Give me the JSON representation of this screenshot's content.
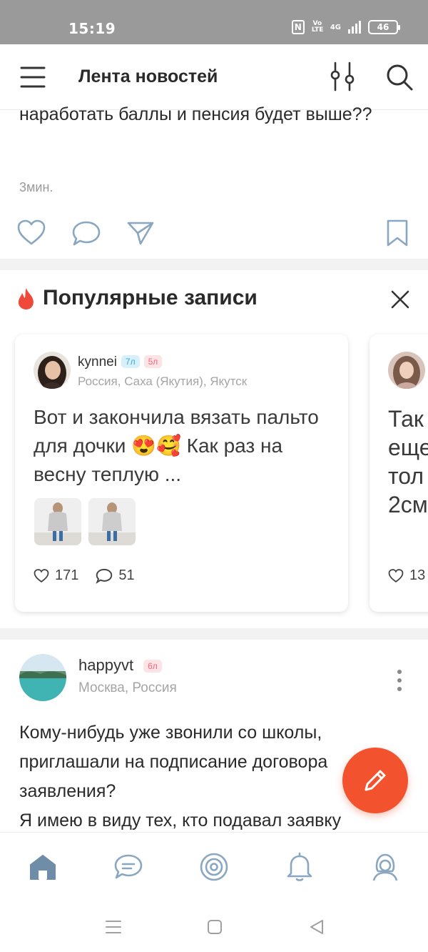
{
  "status_bar": {
    "time": "15:19",
    "nfc": "N",
    "volte": "Vo LTE",
    "network": "4G",
    "battery": "46"
  },
  "header": {
    "title": "Лента новостей",
    "menu_icon": "hamburger-icon",
    "filter_icon": "filter-icon",
    "search_icon": "search-icon"
  },
  "post1": {
    "text": "наработать баллы и пенсия будет выше??",
    "time": "3мин."
  },
  "popular": {
    "title": "Популярные записи",
    "fire_color": "#f0493a",
    "cards": [
      {
        "author": "kynnei",
        "badge_blue": "7л",
        "badge_pink": "5л",
        "location": "Россия, Саха (Якутия), Якутск",
        "text": "Вот и закончила вязать пальто для дочки 😍🥰 Как раз на весну теплую ...",
        "likes": "171",
        "comments": "51"
      },
      {
        "text": "Так еще тол 2см",
        "likes": "13"
      }
    ]
  },
  "post3": {
    "author": "happyvt",
    "badge_pink": "6л",
    "location": "Москва, Россия",
    "text_lines": [
      "Кому-нибудь уже звонили со школы,",
      "приглашали на подписание договора",
      "заявления?",
      "Я имею в виду тех, кто подавал заявку"
    ]
  },
  "colors": {
    "accent": "#f2522e",
    "status_bar": "#9a9a9a",
    "tab_active": "#6f8da8",
    "tab_inactive": "#8aa7c2"
  }
}
